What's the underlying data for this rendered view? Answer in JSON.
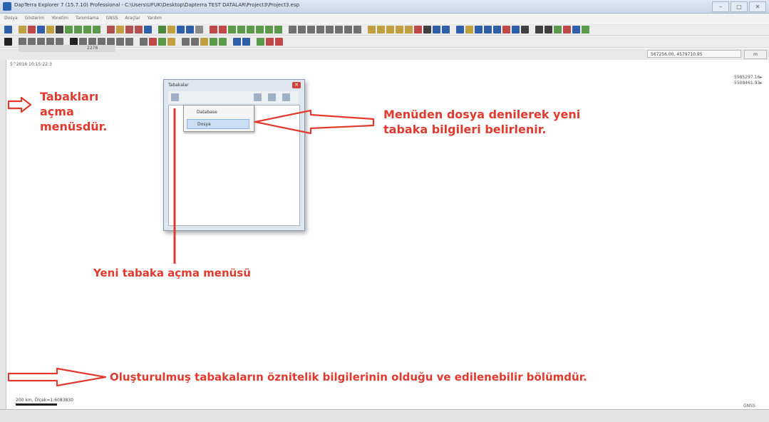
{
  "window": {
    "title": "DapTerra Explorer 7 (15.7.10) Professional - C:\\Users\\UFUK\\Desktop\\Dapterra TEST DATALAR\\Project3\\Project3.esp",
    "controls": [
      "–",
      "□",
      "✕"
    ]
  },
  "menu": [
    "Dosya",
    "Gösterim",
    "Yönetim",
    "Tanımlama",
    "GNSS",
    "Araçlar",
    "Yardım"
  ],
  "toolbar": {
    "row1_icon_colors": [
      "#2f5fa8",
      "#c0a040",
      "#c04848",
      "#2f5fa8",
      "#c0a040",
      "#404040",
      "#5a9a4a",
      "#5a9a4a",
      "#5a9a4a",
      "#5a9a4a",
      "#b05050",
      "#c0a040",
      "#b05050",
      "#b05050",
      "#2f5fa8",
      "#4a8a3a",
      "#c0a040",
      "#2f5fa8",
      "#2f5fa8",
      "#8a8a8a",
      "#c04848",
      "#c04848",
      "#5a9a4a",
      "#5a9a4a",
      "#5a9a4a",
      "#5a9a4a",
      "#5a9a4a",
      "#5a9a4a",
      "#707070",
      "#707070",
      "#707070",
      "#707070",
      "#707070",
      "#707070",
      "#707070",
      "#707070",
      "#c0a040",
      "#c0a040",
      "#c0a040",
      "#c0a040",
      "#c0a040",
      "#c04848",
      "#404040",
      "#2f5fa8",
      "#2f5fa8",
      "#2f5fa8",
      "#c0a040",
      "#2f5fa8",
      "#2f5fa8",
      "#2f5fa8",
      "#c04848",
      "#2f5fa8",
      "#404040",
      "#404040",
      "#404040",
      "#5a9a4a",
      "#c04848",
      "#2f5fa8",
      "#5a9a4a"
    ],
    "row2_icon_colors": [
      "#222222",
      "#707070",
      "#707070",
      "#707070",
      "#707070",
      "#707070",
      "#222222",
      "#707070",
      "#707070",
      "#707070",
      "#707070",
      "#707070",
      "#707070",
      "#707070",
      "#c04848",
      "#5a9a4a",
      "#c0a040",
      "#707070",
      "#707070",
      "#c0a040",
      "#5a9a4a",
      "#5a9a4a",
      "#2f5fa8",
      "#2f5fa8",
      "#5a9a4a",
      "#c04848",
      "#c04848"
    ]
  },
  "status": {
    "coordinates": "567256.00, 4579710.95",
    "extra": "m",
    "date_label": "5^2016 10:15:22:3",
    "right_coords": [
      "5985297.16▸",
      "5508461.93▸"
    ],
    "scale_text": "200 km, Ölçek=1:6083830",
    "gnss": "GNSS"
  },
  "dialog": {
    "title": "Tabakalar",
    "close": "✕",
    "context_menu": [
      "Database",
      "Dosya"
    ],
    "list_row_text": "2276"
  },
  "annotations": {
    "tabakalar_menu": [
      "Tabakları",
      "açma",
      "menüsdür."
    ],
    "menu_dosya": [
      "Menüden dosya denilerek yeni",
      "tabaka bilgileri belirlenir."
    ],
    "yeni_tabaka": "Yeni tabaka açma menüsü",
    "oznitelik": "Oluşturulmuş tabakaların öznitelik bilgilerinin olduğu ve edilenebilir bölümdür."
  },
  "colors": {
    "annotation": "#e03a2f"
  }
}
